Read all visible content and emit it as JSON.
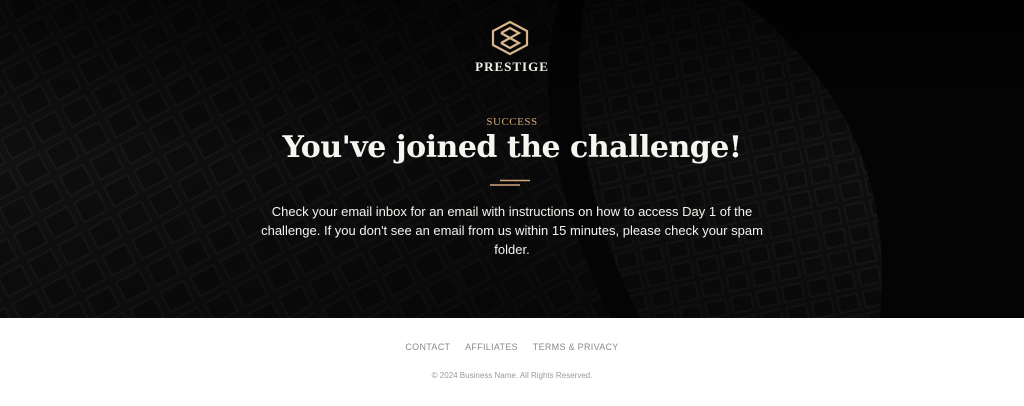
{
  "hero": {
    "brand_name": "PRESTIGE",
    "logo_icon": "prestige-monogram-icon",
    "eyebrow": "SUCCESS",
    "headline": "You've joined the challenge!",
    "message": "Check your email inbox for an email with instructions on how to access Day 1 of the challenge. If you don't see an email from us within 15 minutes, please check your spam folder.",
    "background_image": "dark-skyscraper-photo"
  },
  "footer": {
    "links": [
      "CONTACT",
      "AFFILIATES",
      "TERMS & PRIVACY"
    ],
    "copyright": "© 2024 Business Name. All Rights Reserved."
  },
  "colors": {
    "accent_gold": "#d2a679",
    "hero_background": "#0c0c0c",
    "footer_background": "#ffffff"
  }
}
